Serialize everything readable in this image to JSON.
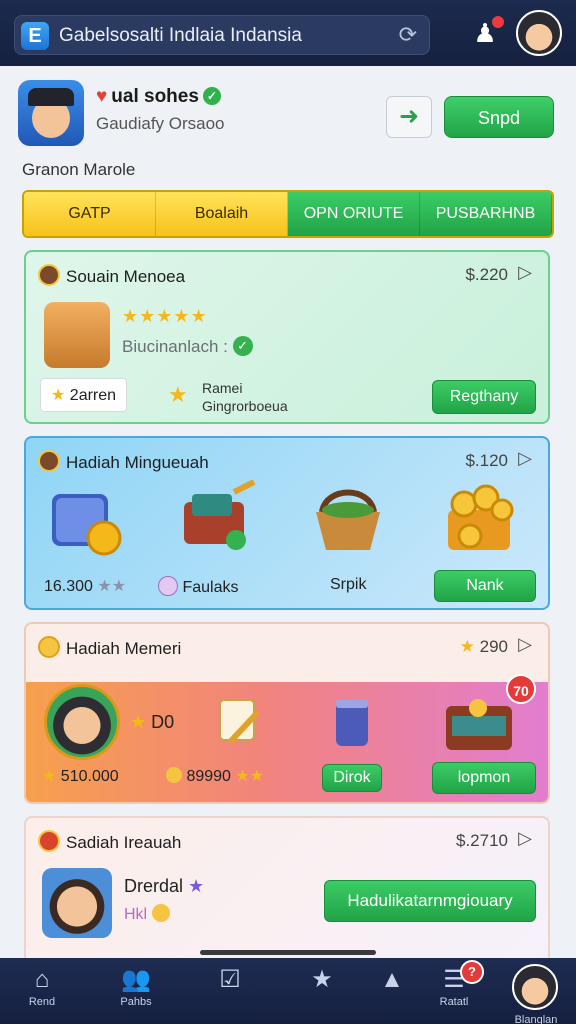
{
  "header": {
    "app_icon": "E",
    "url": "Gabelsosalti Indlaia Indansia",
    "reload_icon": "reload-icon",
    "notification_icon": "bell-icon"
  },
  "profile": {
    "name": "ual sohes",
    "subtitle": "Gaudiafy Orsaoo",
    "share_icon": "arrow-right-icon",
    "action_label": "Snpd"
  },
  "section_label": "Granon Marole",
  "tabs": [
    {
      "label": "GATP"
    },
    {
      "label": "Boalaih"
    },
    {
      "label": "OPN ORIUTE"
    },
    {
      "label": "PUSBARHNB"
    }
  ],
  "cards": {
    "card1": {
      "title": "Souain Menoea",
      "price": "$.220",
      "rating": "★★★★★",
      "subtitle": "Biucinanlach :",
      "badge_value": "2arren",
      "note_line1": "Ramei",
      "note_line2": "Gingrorboeua",
      "button": "Regthany"
    },
    "card2": {
      "title": "Hadiah Mingueuah",
      "price": "$.120",
      "stat_value": "16.300",
      "stat_stars": "★★",
      "item2_label": "Faulaks",
      "item3_label": "Srpik",
      "button": "Nank"
    },
    "card3": {
      "title": "Hadiah Memeri",
      "price": "290",
      "star_label": "D0",
      "value1": "510.000",
      "value2": "89990",
      "value2_stars": "★★",
      "btn1": "Dirok",
      "btn2": "lopmon",
      "badge": "70"
    },
    "card4": {
      "title": "Sadiah Ireauah",
      "price": "$.2710",
      "name": "Drerdal",
      "sub": "Hkl",
      "button": "Hadulikatarnmgiouary"
    }
  },
  "nav": [
    {
      "label": "Rend",
      "icon": "home-icon"
    },
    {
      "label": "Pahbs",
      "icon": "people-icon"
    },
    {
      "label": "",
      "icon": "check-icon"
    },
    {
      "label": "",
      "icon": "star-icon"
    },
    {
      "label": "",
      "icon": "triangle-icon"
    },
    {
      "label": "Ratatl",
      "icon": "menu-icon",
      "badge": "?"
    },
    {
      "label": "Blanglan",
      "icon": "avatar-icon"
    }
  ]
}
